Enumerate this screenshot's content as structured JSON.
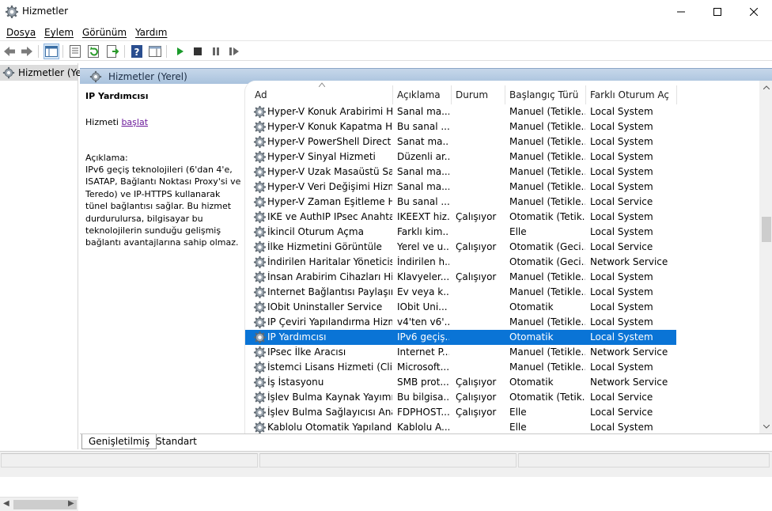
{
  "window": {
    "title": "Hizmetler",
    "icons": {
      "app": "gear-icon",
      "minimize": "minimize-icon",
      "maximize": "maximize-icon",
      "close": "close-icon"
    }
  },
  "menu": [
    "Dosya",
    "Eylem",
    "Görünüm",
    "Yardım"
  ],
  "toolbar": {
    "icons": [
      "back-icon",
      "forward-icon",
      "console-tree-icon",
      "properties-icon",
      "refresh-icon",
      "export-list-icon",
      "help-icon",
      "show-hide-icon",
      "play-icon",
      "stop-icon",
      "pause-icon",
      "resume-icon"
    ]
  },
  "tree": {
    "item": "Hizmetler (Yerel)"
  },
  "pane": {
    "header": "Hizmetler (Yerel)"
  },
  "details": {
    "title": "IP Yardımcısı",
    "start_prefix": "Hizmeti ",
    "start_link": "başlat",
    "desc_label": "Açıklama:",
    "desc_text": "IPv6 geçiş teknolojileri (6'dan 4'e, ISATAP, Bağlantı Noktası Proxy'si ve Teredo) ve IP-HTTPS kullanarak tünel bağlantısı sağlar. Bu hizmet durdurulursa, bilgisayar bu teknolojilerin sunduğu gelişmiş bağlantı avantajlarına sahip olmaz."
  },
  "columns": [
    "Ad",
    "Açıklama",
    "Durum",
    "Başlangıç Türü",
    "Farklı Oturum Aç"
  ],
  "services": [
    {
      "name": "Hyper-V Konuk Arabirimi H...",
      "desc": "Sanal ma...",
      "state": "",
      "start": "Manuel (Tetikle...",
      "logon": "Local System"
    },
    {
      "name": "Hyper-V Konuk Kapatma Hi...",
      "desc": "Bu sanal ...",
      "state": "",
      "start": "Manuel (Tetikle...",
      "logon": "Local System"
    },
    {
      "name": "Hyper-V PowerShell Direct ...",
      "desc": "Sanat ma...",
      "state": "",
      "start": "Manuel (Tetikle...",
      "logon": "Local System"
    },
    {
      "name": "Hyper-V Sinyal Hizmeti",
      "desc": "Düzenli ar...",
      "state": "",
      "start": "Manuel (Tetikle...",
      "logon": "Local System"
    },
    {
      "name": "Hyper-V Uzak Masaüstü Sa...",
      "desc": "Sanal ma...",
      "state": "",
      "start": "Manuel (Tetikle...",
      "logon": "Local System"
    },
    {
      "name": "Hyper-V Veri Değişimi Hizm...",
      "desc": "Sanal ma...",
      "state": "",
      "start": "Manuel (Tetikle...",
      "logon": "Local System"
    },
    {
      "name": "Hyper-V Zaman Eşitleme Hi...",
      "desc": "Bu sanal ...",
      "state": "",
      "start": "Manuel (Tetikle...",
      "logon": "Local Service"
    },
    {
      "name": "IKE ve AuthIP IPsec Anahtar...",
      "desc": "IKEEXT hiz...",
      "state": "Çalışıyor",
      "start": "Otomatik (Tetik...",
      "logon": "Local System"
    },
    {
      "name": "İkincil Oturum Açma",
      "desc": "Farklı kim...",
      "state": "",
      "start": "Elle",
      "logon": "Local System"
    },
    {
      "name": "İlke Hizmetini Görüntüle",
      "desc": "Yerel ve u...",
      "state": "Çalışıyor",
      "start": "Otomatik (Geci...",
      "logon": "Local Service"
    },
    {
      "name": "İndirilen Haritalar Yöneticisi",
      "desc": "İndirilen h...",
      "state": "",
      "start": "Otomatik (Geci...",
      "logon": "Network Service"
    },
    {
      "name": "İnsan Arabirim Cihazları Hiz...",
      "desc": "Klavyeler...",
      "state": "Çalışıyor",
      "start": "Manuel (Tetikle...",
      "logon": "Local System"
    },
    {
      "name": "Internet Bağlantısı Paylaşım...",
      "desc": "Ev veya k...",
      "state": "",
      "start": "Manuel (Tetikle...",
      "logon": "Local System"
    },
    {
      "name": "IObit Uninstaller Service",
      "desc": "IObit Uni...",
      "state": "",
      "start": "Otomatik",
      "logon": "Local System"
    },
    {
      "name": "IP Çeviri Yapılandırma Hizm...",
      "desc": "v4'ten v6'...",
      "state": "",
      "start": "Manuel (Tetikle...",
      "logon": "Local System"
    },
    {
      "name": "IP Yardımcısı",
      "desc": "IPv6 geçiş...",
      "state": "",
      "start": "Otomatik",
      "logon": "Local System",
      "selected": true
    },
    {
      "name": "IPsec İlke Aracısı",
      "desc": "Internet P...",
      "state": "",
      "start": "Manuel (Tetikle...",
      "logon": "Network Service"
    },
    {
      "name": "İstemci Lisans Hizmeti (Clip...",
      "desc": "Microsoft...",
      "state": "",
      "start": "Manuel (Tetikle...",
      "logon": "Local System"
    },
    {
      "name": "İş İstasyonu",
      "desc": "SMB prot...",
      "state": "Çalışıyor",
      "start": "Otomatik",
      "logon": "Network Service"
    },
    {
      "name": "İşlev Bulma Kaynak Yayımı",
      "desc": "Bu bilgisa...",
      "state": "Çalışıyor",
      "start": "Otomatik (Tetik...",
      "logon": "Local Service"
    },
    {
      "name": "İşlev Bulma Sağlayıcısı Ana ...",
      "desc": "FDPHOST...",
      "state": "Çalışıyor",
      "start": "Elle",
      "logon": "Local Service"
    },
    {
      "name": "Kablolu Otomatik Yapılandı...",
      "desc": "Kablolu A...",
      "state": "",
      "start": "Elle",
      "logon": "Local System"
    }
  ],
  "tabs": [
    "Genişletilmiş",
    "Standart"
  ],
  "colors": {
    "selection": "#0a74d6",
    "pane_header": "#b5cbe3",
    "link": "#6b1a9a",
    "play": "#1a9a2a"
  }
}
